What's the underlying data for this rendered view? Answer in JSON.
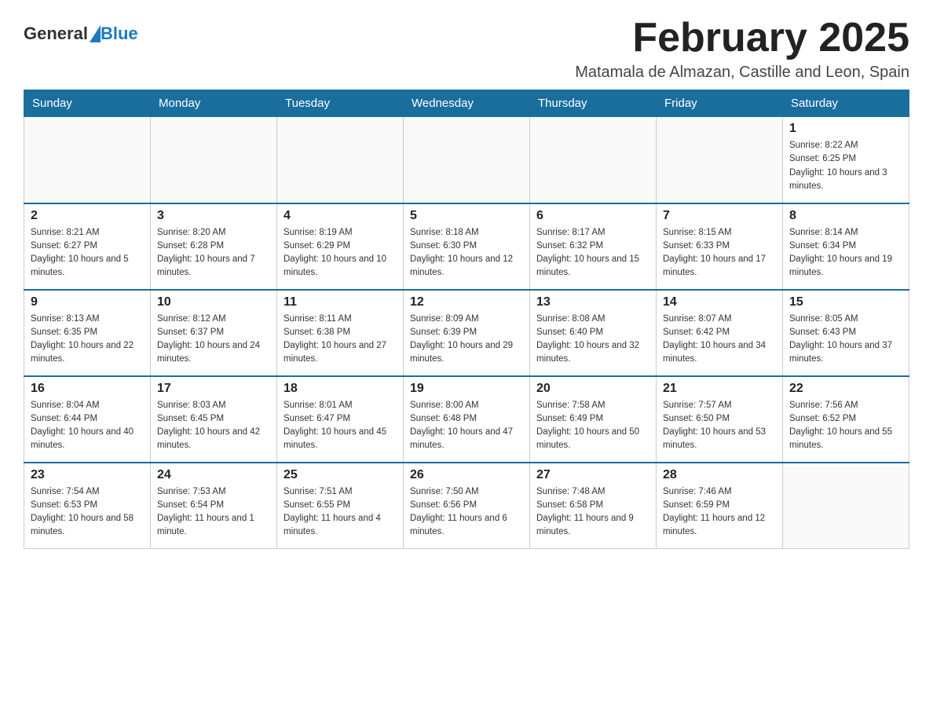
{
  "header": {
    "logo": {
      "general": "General",
      "blue": "Blue"
    },
    "title": "February 2025",
    "subtitle": "Matamala de Almazan, Castille and Leon, Spain"
  },
  "days_of_week": [
    "Sunday",
    "Monday",
    "Tuesday",
    "Wednesday",
    "Thursday",
    "Friday",
    "Saturday"
  ],
  "weeks": [
    [
      {
        "day": "",
        "sunrise": "",
        "sunset": "",
        "daylight": ""
      },
      {
        "day": "",
        "sunrise": "",
        "sunset": "",
        "daylight": ""
      },
      {
        "day": "",
        "sunrise": "",
        "sunset": "",
        "daylight": ""
      },
      {
        "day": "",
        "sunrise": "",
        "sunset": "",
        "daylight": ""
      },
      {
        "day": "",
        "sunrise": "",
        "sunset": "",
        "daylight": ""
      },
      {
        "day": "",
        "sunrise": "",
        "sunset": "",
        "daylight": ""
      },
      {
        "day": "1",
        "sunrise": "Sunrise: 8:22 AM",
        "sunset": "Sunset: 6:25 PM",
        "daylight": "Daylight: 10 hours and 3 minutes."
      }
    ],
    [
      {
        "day": "2",
        "sunrise": "Sunrise: 8:21 AM",
        "sunset": "Sunset: 6:27 PM",
        "daylight": "Daylight: 10 hours and 5 minutes."
      },
      {
        "day": "3",
        "sunrise": "Sunrise: 8:20 AM",
        "sunset": "Sunset: 6:28 PM",
        "daylight": "Daylight: 10 hours and 7 minutes."
      },
      {
        "day": "4",
        "sunrise": "Sunrise: 8:19 AM",
        "sunset": "Sunset: 6:29 PM",
        "daylight": "Daylight: 10 hours and 10 minutes."
      },
      {
        "day": "5",
        "sunrise": "Sunrise: 8:18 AM",
        "sunset": "Sunset: 6:30 PM",
        "daylight": "Daylight: 10 hours and 12 minutes."
      },
      {
        "day": "6",
        "sunrise": "Sunrise: 8:17 AM",
        "sunset": "Sunset: 6:32 PM",
        "daylight": "Daylight: 10 hours and 15 minutes."
      },
      {
        "day": "7",
        "sunrise": "Sunrise: 8:15 AM",
        "sunset": "Sunset: 6:33 PM",
        "daylight": "Daylight: 10 hours and 17 minutes."
      },
      {
        "day": "8",
        "sunrise": "Sunrise: 8:14 AM",
        "sunset": "Sunset: 6:34 PM",
        "daylight": "Daylight: 10 hours and 19 minutes."
      }
    ],
    [
      {
        "day": "9",
        "sunrise": "Sunrise: 8:13 AM",
        "sunset": "Sunset: 6:35 PM",
        "daylight": "Daylight: 10 hours and 22 minutes."
      },
      {
        "day": "10",
        "sunrise": "Sunrise: 8:12 AM",
        "sunset": "Sunset: 6:37 PM",
        "daylight": "Daylight: 10 hours and 24 minutes."
      },
      {
        "day": "11",
        "sunrise": "Sunrise: 8:11 AM",
        "sunset": "Sunset: 6:38 PM",
        "daylight": "Daylight: 10 hours and 27 minutes."
      },
      {
        "day": "12",
        "sunrise": "Sunrise: 8:09 AM",
        "sunset": "Sunset: 6:39 PM",
        "daylight": "Daylight: 10 hours and 29 minutes."
      },
      {
        "day": "13",
        "sunrise": "Sunrise: 8:08 AM",
        "sunset": "Sunset: 6:40 PM",
        "daylight": "Daylight: 10 hours and 32 minutes."
      },
      {
        "day": "14",
        "sunrise": "Sunrise: 8:07 AM",
        "sunset": "Sunset: 6:42 PM",
        "daylight": "Daylight: 10 hours and 34 minutes."
      },
      {
        "day": "15",
        "sunrise": "Sunrise: 8:05 AM",
        "sunset": "Sunset: 6:43 PM",
        "daylight": "Daylight: 10 hours and 37 minutes."
      }
    ],
    [
      {
        "day": "16",
        "sunrise": "Sunrise: 8:04 AM",
        "sunset": "Sunset: 6:44 PM",
        "daylight": "Daylight: 10 hours and 40 minutes."
      },
      {
        "day": "17",
        "sunrise": "Sunrise: 8:03 AM",
        "sunset": "Sunset: 6:45 PM",
        "daylight": "Daylight: 10 hours and 42 minutes."
      },
      {
        "day": "18",
        "sunrise": "Sunrise: 8:01 AM",
        "sunset": "Sunset: 6:47 PM",
        "daylight": "Daylight: 10 hours and 45 minutes."
      },
      {
        "day": "19",
        "sunrise": "Sunrise: 8:00 AM",
        "sunset": "Sunset: 6:48 PM",
        "daylight": "Daylight: 10 hours and 47 minutes."
      },
      {
        "day": "20",
        "sunrise": "Sunrise: 7:58 AM",
        "sunset": "Sunset: 6:49 PM",
        "daylight": "Daylight: 10 hours and 50 minutes."
      },
      {
        "day": "21",
        "sunrise": "Sunrise: 7:57 AM",
        "sunset": "Sunset: 6:50 PM",
        "daylight": "Daylight: 10 hours and 53 minutes."
      },
      {
        "day": "22",
        "sunrise": "Sunrise: 7:56 AM",
        "sunset": "Sunset: 6:52 PM",
        "daylight": "Daylight: 10 hours and 55 minutes."
      }
    ],
    [
      {
        "day": "23",
        "sunrise": "Sunrise: 7:54 AM",
        "sunset": "Sunset: 6:53 PM",
        "daylight": "Daylight: 10 hours and 58 minutes."
      },
      {
        "day": "24",
        "sunrise": "Sunrise: 7:53 AM",
        "sunset": "Sunset: 6:54 PM",
        "daylight": "Daylight: 11 hours and 1 minute."
      },
      {
        "day": "25",
        "sunrise": "Sunrise: 7:51 AM",
        "sunset": "Sunset: 6:55 PM",
        "daylight": "Daylight: 11 hours and 4 minutes."
      },
      {
        "day": "26",
        "sunrise": "Sunrise: 7:50 AM",
        "sunset": "Sunset: 6:56 PM",
        "daylight": "Daylight: 11 hours and 6 minutes."
      },
      {
        "day": "27",
        "sunrise": "Sunrise: 7:48 AM",
        "sunset": "Sunset: 6:58 PM",
        "daylight": "Daylight: 11 hours and 9 minutes."
      },
      {
        "day": "28",
        "sunrise": "Sunrise: 7:46 AM",
        "sunset": "Sunset: 6:59 PM",
        "daylight": "Daylight: 11 hours and 12 minutes."
      },
      {
        "day": "",
        "sunrise": "",
        "sunset": "",
        "daylight": ""
      }
    ]
  ]
}
